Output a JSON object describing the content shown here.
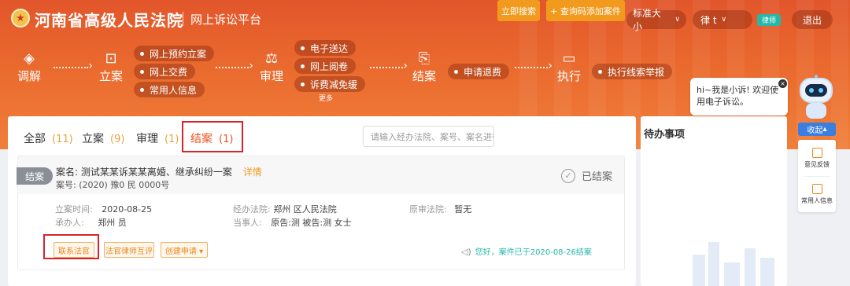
{
  "header": {
    "court_name": "河南省高级人民法院",
    "platform": "网上诉讼平台",
    "font_size": "标准大小",
    "user": "律  t",
    "user_badge": "律师",
    "logout": "退出"
  },
  "flow": {
    "mediate": "调解",
    "filing": "立案",
    "filing_items": [
      "网上预约立案",
      "网上交费",
      "常用人信息"
    ],
    "trial": "审理",
    "trial_items": [
      "电子送达",
      "网上阅卷",
      "诉费减免缓"
    ],
    "more": "更多",
    "close": "结案",
    "close_items": [
      "申请退费"
    ],
    "execute": "执行",
    "execute_items": [
      "执行线索举报"
    ]
  },
  "tabs": [
    {
      "label": "全部",
      "count": "(11)"
    },
    {
      "label": "立案",
      "count": "(9)"
    },
    {
      "label": "审理",
      "count": "(1)"
    },
    {
      "label": "结案",
      "count": "(1)"
    }
  ],
  "search": {
    "placeholder": "请输入经办法院、案号、案名进行",
    "search_button": "立即搜索",
    "add_button": "+ 查询码添加案件"
  },
  "case": {
    "status_tag": "结案",
    "name_label": "案名:",
    "name_value": "测试某某诉某某离婚、继承纠纷一案",
    "detail_link": "详情",
    "number_label": "案号:",
    "number_value": "(2020) 豫0 民 0000号",
    "closed_status": "已结案",
    "filing_time_label": "立案时间:",
    "filing_time": "2020-08-25",
    "court_label": "经办法院:",
    "court_value": "郑州 区人民法院",
    "orig_court_label": "原审法院:",
    "orig_court_value": "暂无",
    "handler_label": "承办人:",
    "handler_value": "郑州 员",
    "party_label": "当事人:",
    "party_value": "原告:测 被告:测 女士",
    "buttons": [
      "联系法官",
      "法官律师互评",
      "创建申请 ▾"
    ],
    "notice": "您好，案件已于2020-08-26结案"
  },
  "todo": {
    "title": "待办事项"
  },
  "assistant": {
    "bubble": "hi~我是小诉! 欢迎使用电子诉讼。",
    "collapse": "收起",
    "tools": [
      "意见反馈",
      "常用人信息"
    ]
  },
  "colors": {
    "brand_orange": "#e8521d",
    "accent_orange": "#f29a1d",
    "highlight_red": "#d9232a",
    "teal": "#26b7a8"
  }
}
